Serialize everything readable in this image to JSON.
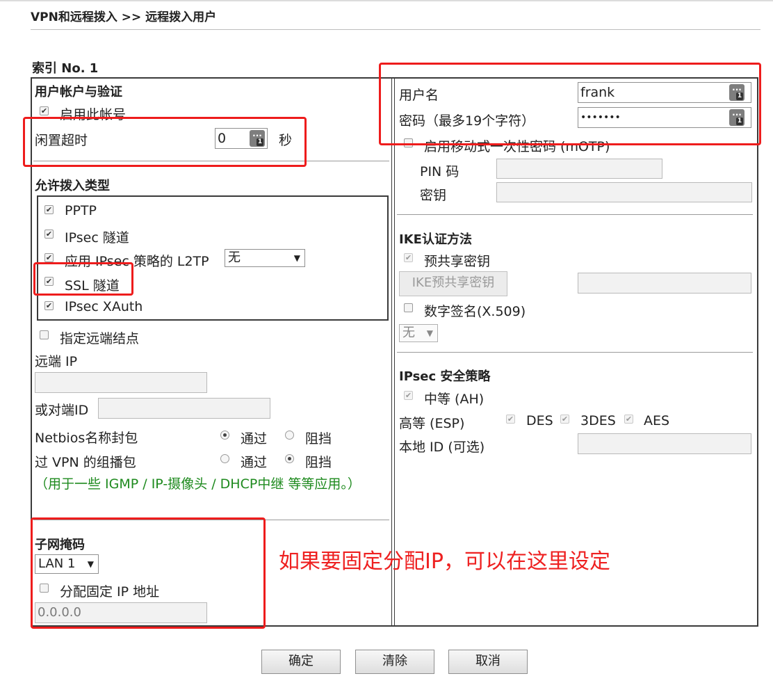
{
  "page_title": "VPN和远程拨入 >> 远程拨入用户",
  "index_label": "索引 No. 1",
  "left": {
    "account_section": "用户帐户与验证",
    "enable_account": "启用此帐号",
    "idle_timeout_label": "闲置超时",
    "idle_timeout_value": "0",
    "idle_timeout_unit": "秒",
    "dial_types_section": "允许拨入类型",
    "pptp": "PPTP",
    "ipsec_tunnel": "IPsec 隧道",
    "l2tp_label": "应用 IPsec 策略的 L2TP",
    "l2tp_select": "无",
    "ssl_tunnel": "SSL 隧道",
    "ipsec_xauth": "IPsec XAuth",
    "specify_remote": "指定远端结点",
    "remote_ip_label": "远端 IP",
    "peer_id_label": "或对端ID",
    "netbios_label": "Netbios名称封包",
    "pass": "通过",
    "block": "阻挡",
    "multicast_label": "过 VPN 的组播包",
    "note": "（用于一些 IGMP / IP-摄像头 / DHCP中继 等等应用。）",
    "subnet_section": "子网掩码",
    "subnet_select": "LAN 1",
    "assign_static": "分配固定 IP 地址",
    "static_ip_value": "0.0.0.0"
  },
  "right": {
    "username_label": "用户名",
    "username_value": "frank",
    "password_label": "密码（最多19个字符）",
    "password_value": "•••••••",
    "motp_label": "启用移动式一次性密码 (mOTP)",
    "pin_label": "PIN 码",
    "secret_label": "密钥",
    "ike_section": "IKE认证方法",
    "preshared_key": "预共享密钥",
    "ike_psk_button": "IKE预共享密钥",
    "digital_sig": "数字签名(X.509)",
    "digital_sig_select": "无",
    "ipsec_section": "IPsec 安全策略",
    "medium_ah": "中等 (AH)",
    "high_esp": "高等 (ESP)",
    "des": "DES",
    "des3": "3DES",
    "aes": "AES",
    "local_id_label": "本地 ID (可选)"
  },
  "annotation": "如果要固定分配IP，可以在这里设定",
  "buttons": {
    "ok": "确定",
    "clear": "清除",
    "cancel": "取消"
  },
  "icons": {
    "password_manager": "password-manager-icon",
    "checkmark": "checkmark-icon"
  },
  "colors": {
    "annotation_red": "#ee1c1c",
    "note_green": "#1e8a1e"
  }
}
